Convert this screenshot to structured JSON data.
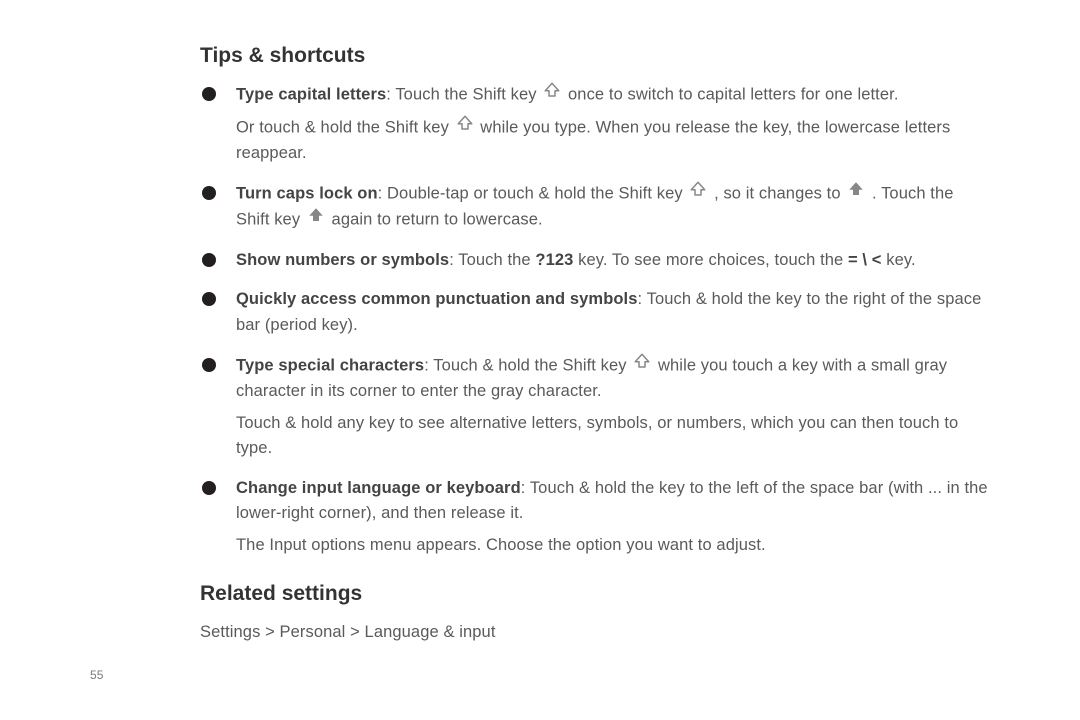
{
  "headings": {
    "tips": "Tips & shortcuts",
    "related": "Related settings"
  },
  "tips": [
    {
      "title": "Type capital letters",
      "body1a": ": Touch the Shift key ",
      "body1b": " once to switch to capital letters for one letter.",
      "follow_a": "Or touch & hold the Shift key ",
      "follow_b": " while you type. When you release the key, the lowercase letters reappear."
    },
    {
      "title": "Turn caps lock on",
      "body1a": ": Double-tap or touch & hold the Shift key ",
      "body1b": " , so it changes to ",
      "body1c": " . Touch the Shift key ",
      "body1d": " again to return to lowercase."
    },
    {
      "title": "Show numbers or symbols",
      "body1a": ": Touch the ",
      "key1": "?123",
      "body1b": " key. To see more choices, touch the ",
      "key2": "= \\ <",
      "body1c": " key."
    },
    {
      "title": "Quickly access common punctuation and symbols",
      "body1a": ": Touch & hold the key to the right of the space bar (period key)."
    },
    {
      "title": "Type special characters",
      "body1a": ": Touch & hold the Shift key ",
      "body1b": " while you touch a key with a small gray character in its corner to enter the gray character.",
      "follow": "Touch & hold any key to see alternative letters, symbols, or numbers, which you can then touch to type."
    },
    {
      "title": "Change input language or keyboard",
      "body1a": ": Touch & hold the key to the left of the space bar (with ... in the lower-right corner), and then release it.",
      "follow": "The Input options menu appears. Choose the option you want to adjust."
    }
  ],
  "related_path": "Settings > Personal > Language & input",
  "page_number": "55"
}
